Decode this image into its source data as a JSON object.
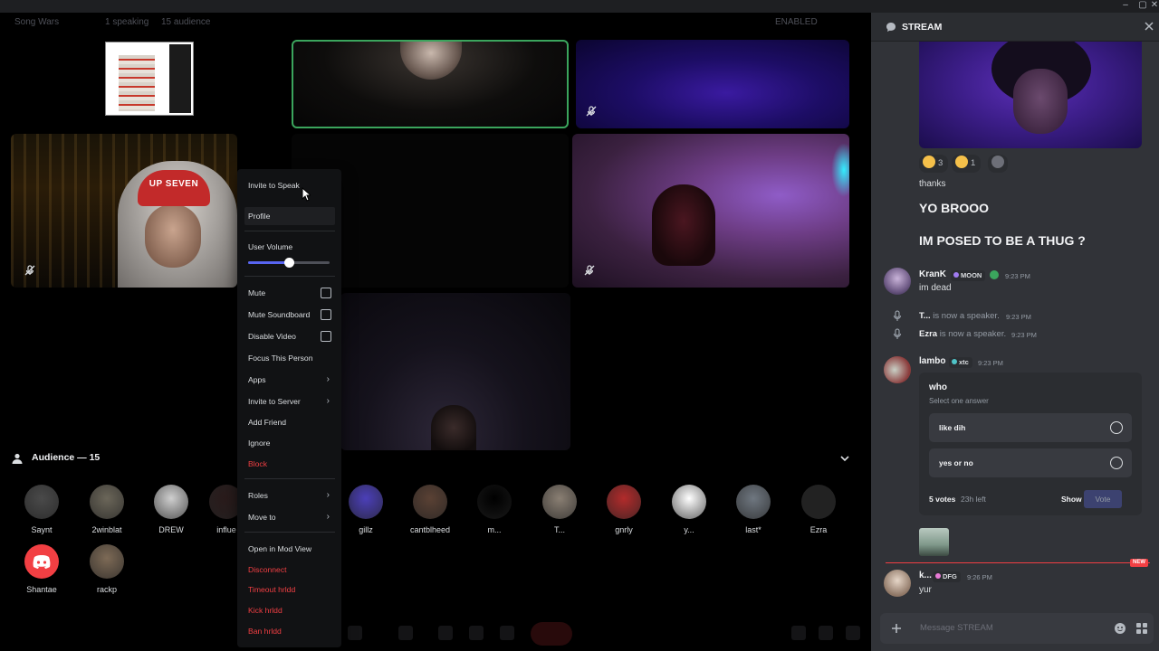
{
  "titlebar": {
    "minimize": "–",
    "maximize": "▢",
    "close": "✕"
  },
  "stage_header": {
    "title": "Song Wars",
    "speaking": "1 speaking",
    "audience": "15 audience",
    "enabled": "ENABLED"
  },
  "audience": {
    "header": "Audience — 15",
    "members": [
      {
        "name": "Saynt",
        "color": "#4a4a4a"
      },
      {
        "name": "2winblat",
        "color": "#6b6659"
      },
      {
        "name": "DREW",
        "color": "#cfcfcf"
      },
      {
        "name": "influe",
        "color": "#2a1b1b"
      },
      {
        "name": "gillz",
        "color": "#4b3fb8"
      },
      {
        "name": "cantblheed",
        "color": "#5a4134"
      },
      {
        "name": "m...",
        "color": "#000000"
      },
      {
        "name": "T...",
        "color": "#8a7f73"
      },
      {
        "name": "gnrly",
        "color": "#b22b2b"
      },
      {
        "name": "y...",
        "color": "#ffffff"
      },
      {
        "name": "last*",
        "color": "#6f7780"
      },
      {
        "name": "Ezra",
        "color": "#222222"
      },
      {
        "name": "Shantae",
        "color": "#f23f43"
      },
      {
        "name": "rackp",
        "color": "#7d6a56"
      }
    ]
  },
  "menu": {
    "invite_to_speak": "Invite to Speak",
    "profile": "Profile",
    "user_volume": "User Volume",
    "user_volume_level": 0.5,
    "mute": "Mute",
    "mute_soundboard": "Mute Soundboard",
    "disable_video": "Disable Video",
    "focus": "Focus This Person",
    "apps": "Apps",
    "invite_to_server": "Invite to Server",
    "add_friend": "Add Friend",
    "ignore": "Ignore",
    "block": "Block",
    "roles": "Roles",
    "move_to": "Move to",
    "open_mod_view": "Open in Mod View",
    "disconnect": "Disconnect",
    "timeout": "Timeout hrldd",
    "kick": "Kick hrldd",
    "ban": "Ban hrldd"
  },
  "panel": {
    "title": "STREAM",
    "reactions": [
      {
        "emoji": "crying-face",
        "count": "3"
      },
      {
        "emoji": "laughing-face",
        "count": "1"
      },
      {
        "emoji": "add-reaction",
        "count": ""
      }
    ],
    "msg_thanks": "thanks",
    "msg_yo": "YO BROOO",
    "msg_posed": "IM POSED TO BE A THUG ?",
    "kran": {
      "author": "KranK",
      "badge": "MOON",
      "time": "9:23 PM",
      "text": "im dead"
    },
    "sys1": {
      "name": "T...",
      "text": " is now a speaker.",
      "time": "9:23 PM"
    },
    "sys2": {
      "name": "Ezra",
      "text": " is now a speaker.",
      "time": "9:23 PM"
    },
    "lambo": {
      "author": "lambo",
      "badge": "xtc",
      "time": "9:23 PM"
    },
    "poll": {
      "question": "who",
      "subtitle": "Select one answer",
      "options": [
        "like dih",
        "yes or no"
      ],
      "votes": "5 votes",
      "time_left": "23h left",
      "show_results": "Show results",
      "vote": "Vote"
    },
    "new_tag": "NEW",
    "k": {
      "author": "k...",
      "badge": "DFG",
      "time": "9:26 PM",
      "text": "yur"
    },
    "composer_placeholder": "Message STREAM"
  },
  "colors": {
    "accent": "#5865f2",
    "danger": "#f23f43",
    "speaking": "#3ba55d"
  }
}
